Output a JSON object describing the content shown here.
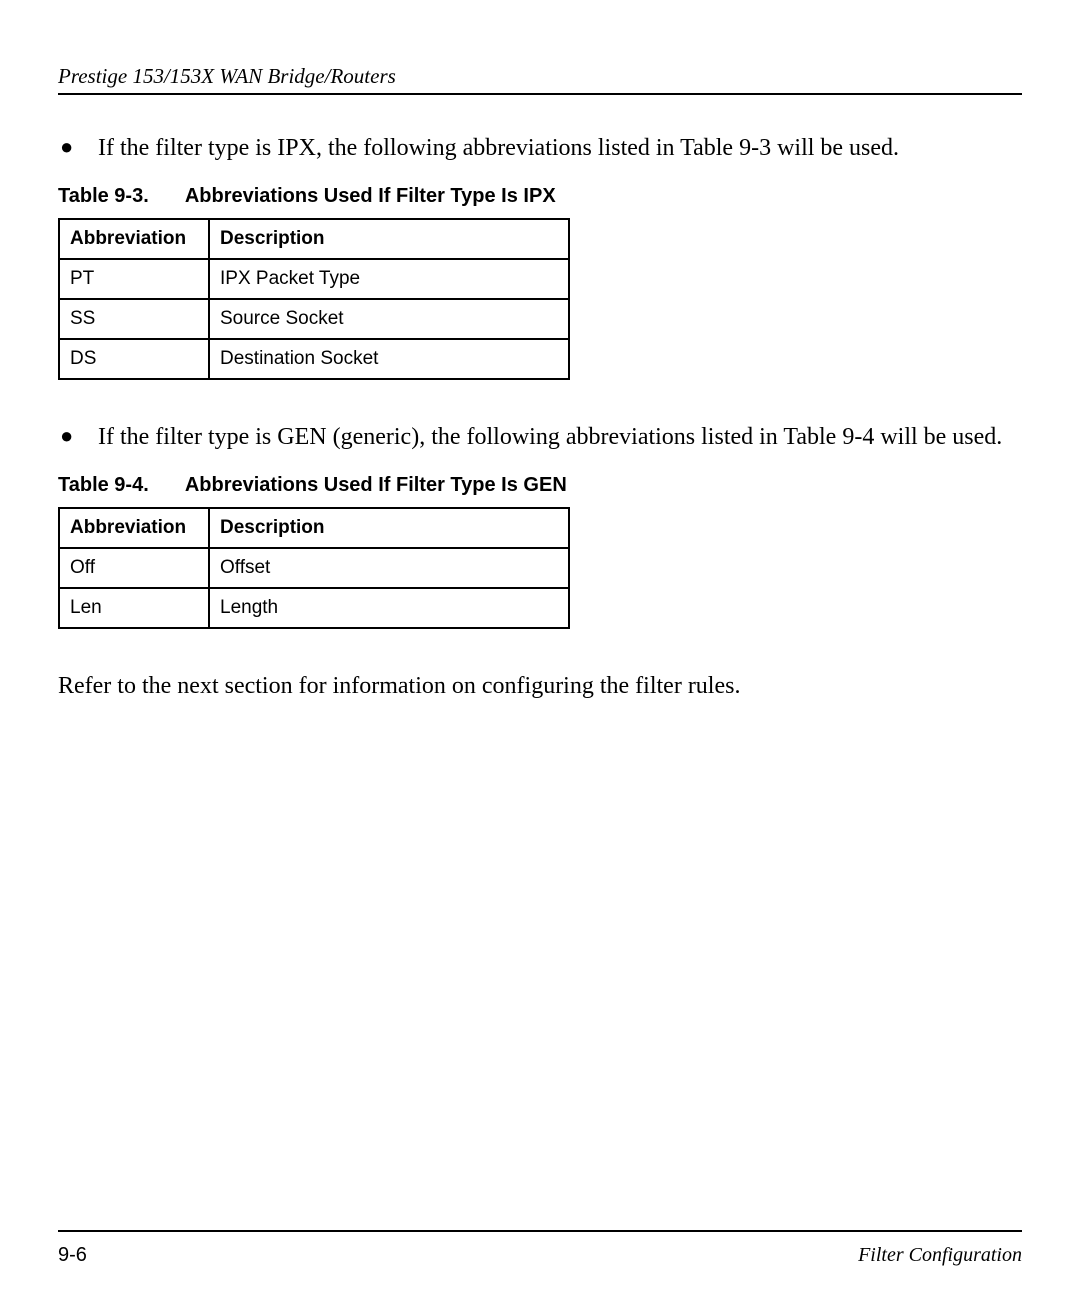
{
  "header": {
    "running_head": "Prestige 153/153X  WAN Bridge/Routers"
  },
  "bullets": {
    "b1": "If the filter type is IPX, the following abbreviations listed in Table 9-3 will be used.",
    "b2": "If the filter type is GEN (generic), the following abbreviations listed in Table 9-4 will be used."
  },
  "table93": {
    "caption_num": "Table 9-3.",
    "caption_title": "Abbreviations Used If Filter Type Is IPX",
    "head_abbr": "Abbreviation",
    "head_desc": "Description",
    "rows": [
      {
        "abbr": "PT",
        "desc": "IPX Packet Type"
      },
      {
        "abbr": "SS",
        "desc": "Source Socket"
      },
      {
        "abbr": "DS",
        "desc": "Destination Socket"
      }
    ]
  },
  "table94": {
    "caption_num": "Table 9-4.",
    "caption_title": "Abbreviations Used If Filter Type Is GEN",
    "head_abbr": "Abbreviation",
    "head_desc": "Description",
    "rows": [
      {
        "abbr": "Off",
        "desc": "Offset"
      },
      {
        "abbr": "Len",
        "desc": "Length"
      }
    ]
  },
  "closing": "Refer to the next section for information on configuring the filter rules.",
  "footer": {
    "page": "9-6",
    "section": "Filter Configuration"
  },
  "chart_data": [
    {
      "type": "table",
      "title": "Abbreviations Used If Filter Type Is IPX",
      "columns": [
        "Abbreviation",
        "Description"
      ],
      "rows": [
        [
          "PT",
          "IPX Packet Type"
        ],
        [
          "SS",
          "Source Socket"
        ],
        [
          "DS",
          "Destination Socket"
        ]
      ]
    },
    {
      "type": "table",
      "title": "Abbreviations Used If Filter Type Is GEN",
      "columns": [
        "Abbreviation",
        "Description"
      ],
      "rows": [
        [
          "Off",
          "Offset"
        ],
        [
          "Len",
          "Length"
        ]
      ]
    }
  ]
}
